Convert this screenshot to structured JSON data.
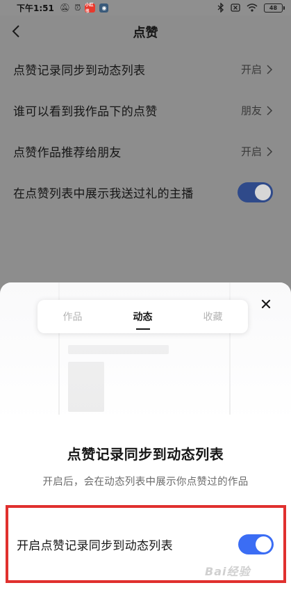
{
  "status_bar": {
    "time": "下午1:51",
    "app_badge": "小红书",
    "battery": "48"
  },
  "header": {
    "title": "点赞"
  },
  "settings": [
    {
      "label": "点赞记录同步到动态列表",
      "value": "开启",
      "type": "link"
    },
    {
      "label": "谁可以看到我作品下的点赞",
      "value": "朋友",
      "type": "link"
    },
    {
      "label": "点赞作品推荐给朋友",
      "value": "开启",
      "type": "link"
    },
    {
      "label": "在点赞列表中展示我送过礼的主播",
      "type": "toggle",
      "on": true
    }
  ],
  "sheet": {
    "tabs": [
      "作品",
      "动态",
      "收藏"
    ],
    "active_tab": "动态",
    "title": "点赞记录同步到动态列表",
    "description": "开启后，会在动态列表中展示你点赞过的作品",
    "toggle_label": "开启点赞记录同步到动态列表",
    "toggle_on": true
  },
  "watermark": "Bai经验",
  "colors": {
    "accent": "#3b6df4",
    "highlight_border": "#e0302e",
    "overlay": "#8d8d8d"
  }
}
